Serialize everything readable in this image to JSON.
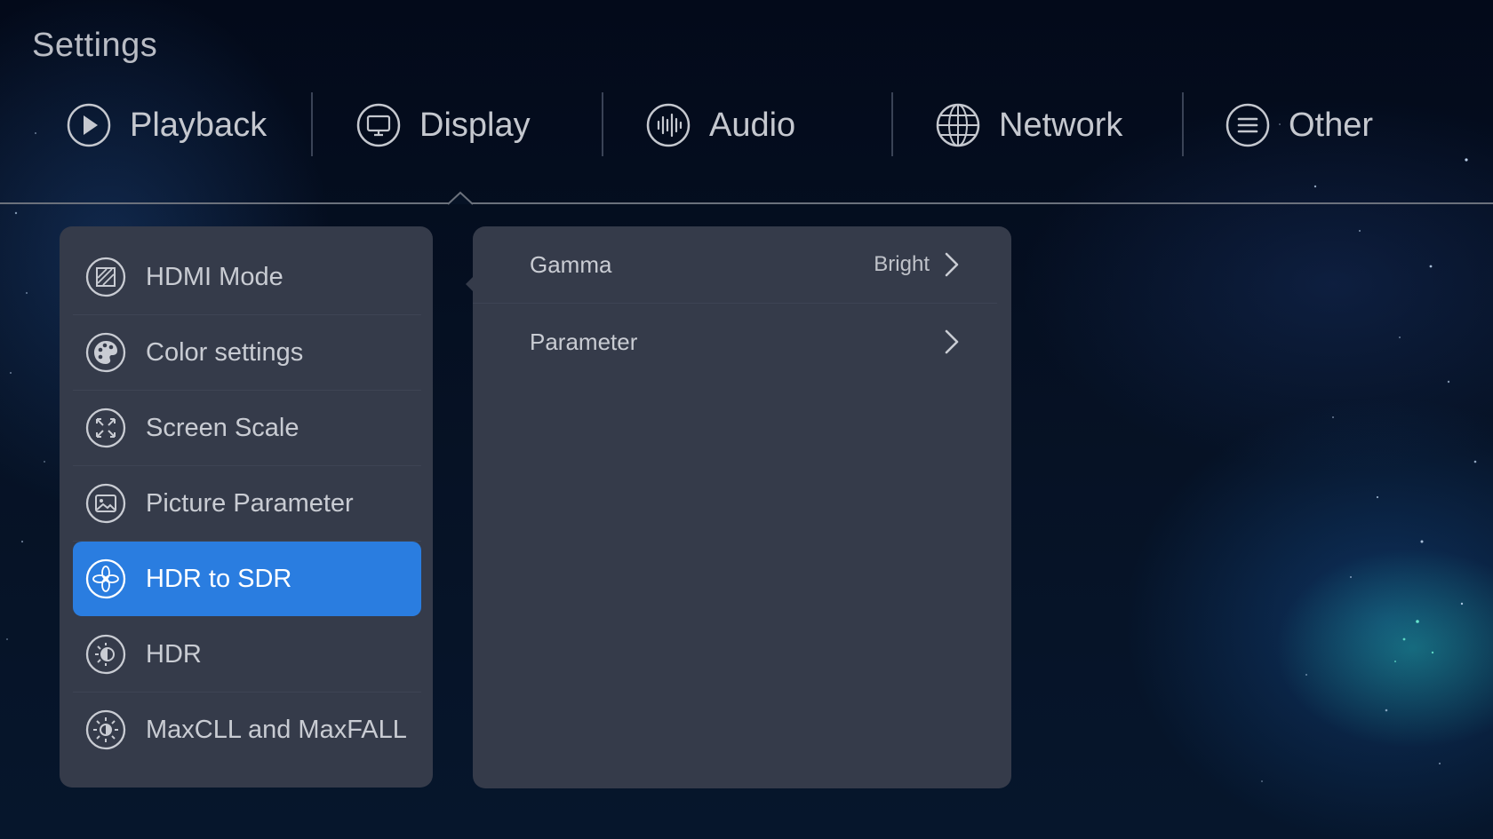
{
  "header": {
    "title": "Settings"
  },
  "tabs": [
    {
      "label": "Playback",
      "icon": "play-icon"
    },
    {
      "label": "Display",
      "icon": "monitor-icon"
    },
    {
      "label": "Audio",
      "icon": "audio-wave-icon"
    },
    {
      "label": "Network",
      "icon": "globe-icon"
    },
    {
      "label": "Other",
      "icon": "menu-lines-icon"
    }
  ],
  "active_tab": "Display",
  "sidebar": {
    "items": [
      {
        "label": "HDMI Mode",
        "icon": "hdmi-mode-icon"
      },
      {
        "label": "Color settings",
        "icon": "palette-icon"
      },
      {
        "label": "Screen Scale",
        "icon": "expand-arrows-icon"
      },
      {
        "label": "Picture Parameter",
        "icon": "picture-icon"
      },
      {
        "label": "HDR to SDR",
        "icon": "flower-icon"
      },
      {
        "label": "HDR",
        "icon": "half-sun-icon"
      },
      {
        "label": "MaxCLL and MaxFALL",
        "icon": "sun-icon"
      }
    ],
    "selected": "HDR to SDR"
  },
  "detail": {
    "rows": [
      {
        "label": "Gamma",
        "value": "Bright"
      },
      {
        "label": "Parameter",
        "value": ""
      }
    ]
  },
  "colors": {
    "accent": "#2a7de0",
    "panel": "#353b4a",
    "text": "#c9ccd3"
  }
}
